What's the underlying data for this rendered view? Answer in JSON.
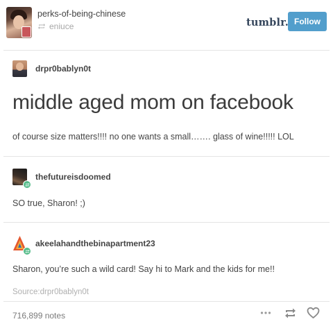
{
  "header": {
    "blog_name": "perks-of-being-chinese",
    "reblogged_from": "eniuce",
    "logo_text": "tumblr.",
    "follow_label": "Follow",
    "follow_color": "#529ecc",
    "logo_color": "#35465c"
  },
  "posts": [
    {
      "username": "drpr0bablyn0t",
      "title": "middle aged mom on facebook",
      "body": "of course size matters!!!! no one wants a small……. glass of wine!!!!! LOL"
    },
    {
      "username": "thefutureisdoomed",
      "body": "SO true, Sharon! ;)"
    },
    {
      "username": "akeelahandthebinapartment23",
      "body": "Sharon, you’re such a wild card! Say hi to Mark and the kids for me!!"
    }
  ],
  "footer": {
    "source": "Source:drpr0bablyn0t",
    "notes": "716,899 notes",
    "icons": [
      "more-icon",
      "reblog-icon",
      "heart-icon"
    ],
    "reblog_badge_color": "#56bc8a"
  }
}
